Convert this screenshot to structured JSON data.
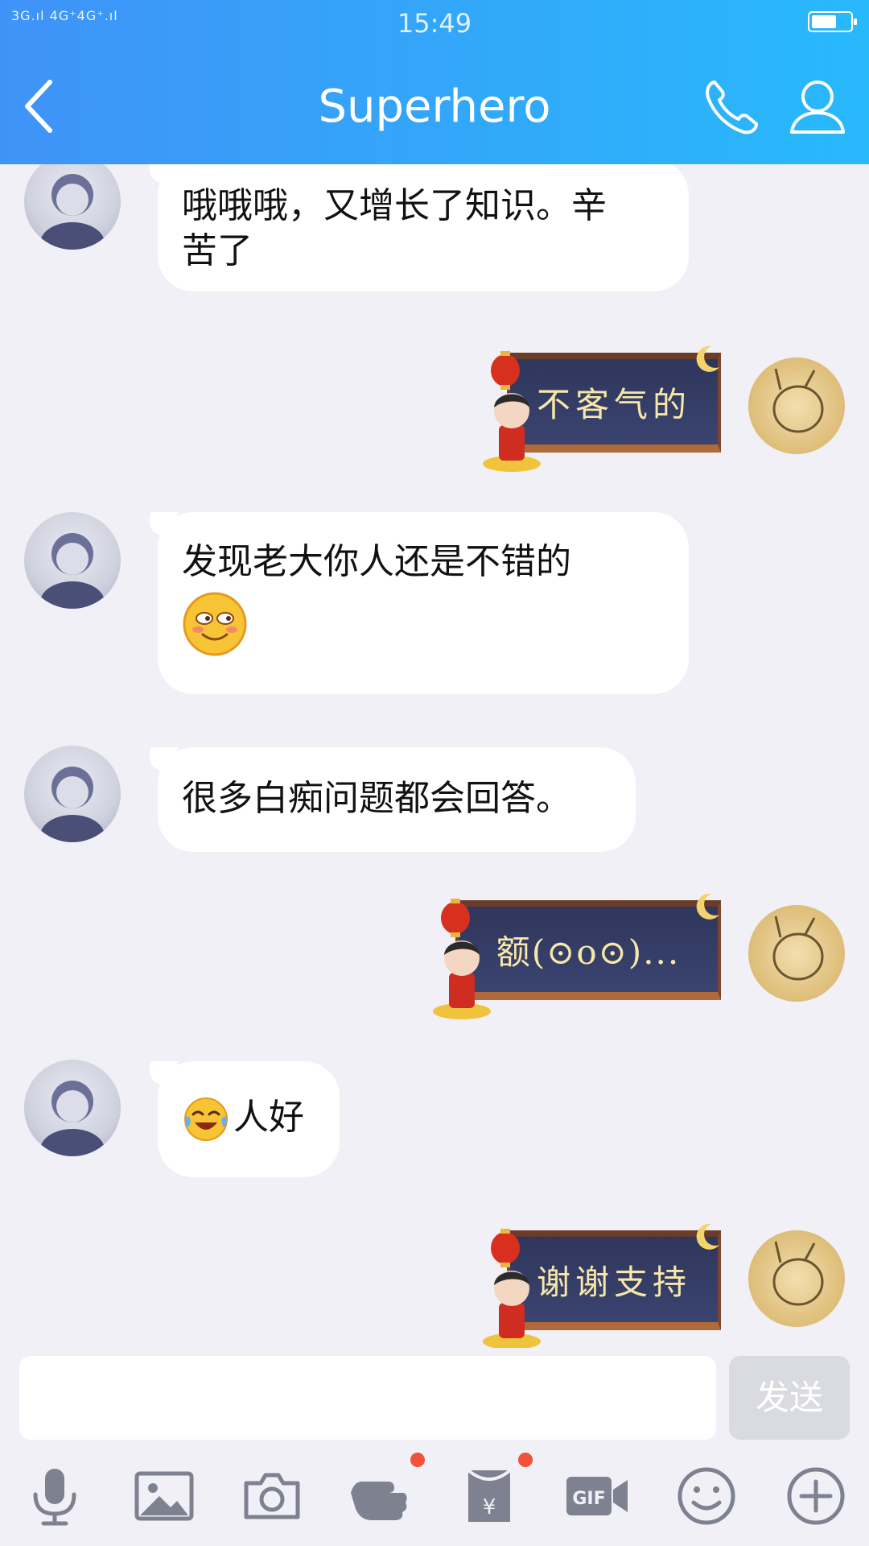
{
  "status": {
    "signal": "3G.ıl 4G⁺4G⁺.ıl",
    "time": "15:49"
  },
  "header": {
    "title": "Superhero"
  },
  "messages": [
    {
      "from": "them",
      "text_line1": "哦哦哦，又增长了知识。辛",
      "text_line2": "苦了"
    },
    {
      "from": "me",
      "sticker_text": "不客气的"
    },
    {
      "from": "them",
      "text_line1": "发现老大你人还是不错的",
      "emoji": "smile-blush-emoji"
    },
    {
      "from": "them",
      "text": "很多白痴问题都会回答。"
    },
    {
      "from": "me",
      "sticker_text": "额(⊙o⊙)..."
    },
    {
      "from": "them",
      "emoji": "laugh-cry-emoji",
      "text": "人好"
    },
    {
      "from": "me",
      "sticker_text": "谢谢支持"
    }
  ],
  "input": {
    "value": "",
    "send_label": "发送"
  },
  "toolbar": {
    "icons": [
      "microphone-icon",
      "image-icon",
      "camera-icon",
      "poke-icon",
      "red-packet-icon",
      "gif-icon",
      "emoji-icon",
      "plus-icon"
    ]
  },
  "colors": {
    "header_start": "#3f93f7",
    "header_end": "#28b9fb",
    "background": "#f0f0f6",
    "badge": "#f2513a"
  }
}
